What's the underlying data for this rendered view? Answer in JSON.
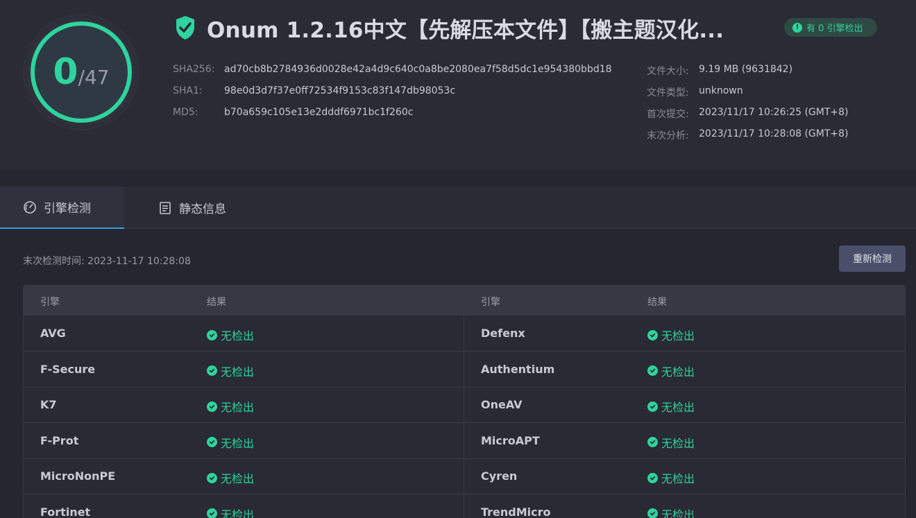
{
  "score": {
    "detected": "0",
    "total": "/47"
  },
  "file": {
    "title": "Onum 1.2.16中文【先解压本文件】【搬主题汉化...",
    "badge": "有 0 引擎检出",
    "badge_icon": "exclamation-icon",
    "hashes": [
      {
        "key": "SHA256:",
        "value": "ad70cb8b2784936d0028e42a4d9c640c0a8be2080ea7f58d5dc1e954380bbd18"
      },
      {
        "key": "SHA1:",
        "value": "98e0d3d7f37e0ff72534f9153c83f147db98053c"
      },
      {
        "key": "MD5:",
        "value": "b70a659c105e13e2dddf6971bc1f260c"
      }
    ],
    "meta": [
      {
        "key": "文件大小:",
        "value": "9.19 MB (9631842)"
      },
      {
        "key": "文件类型:",
        "value": "unknown"
      },
      {
        "key": "首次提交:",
        "value": "2023/11/17 10:26:25 (GMT+8)"
      },
      {
        "key": "末次分析:",
        "value": "2023/11/17 10:28:08 (GMT+8)"
      }
    ]
  },
  "tabs": [
    {
      "label": "引擎检测",
      "icon": "gauge-icon",
      "active": true
    },
    {
      "label": "静态信息",
      "icon": "document-list-icon",
      "active": false
    }
  ],
  "detection": {
    "last_check": "末次检测时间: 2023-11-17 10:28:08",
    "recheck_label": "重新检测",
    "headers": {
      "engine": "引擎",
      "result": "结果"
    },
    "rows": [
      {
        "left": {
          "engine": "AVG",
          "result": "无检出"
        },
        "right": {
          "engine": "Defenx",
          "result": "无检出"
        }
      },
      {
        "left": {
          "engine": "F-Secure",
          "result": "无检出"
        },
        "right": {
          "engine": "Authentium",
          "result": "无检出"
        }
      },
      {
        "left": {
          "engine": "K7",
          "result": "无检出"
        },
        "right": {
          "engine": "OneAV",
          "result": "无检出"
        }
      },
      {
        "left": {
          "engine": "F-Prot",
          "result": "无检出"
        },
        "right": {
          "engine": "MicroAPT",
          "result": "无检出"
        }
      },
      {
        "left": {
          "engine": "MicroNonPE",
          "result": "无检出"
        },
        "right": {
          "engine": "Cyren",
          "result": "无检出"
        }
      },
      {
        "left": {
          "engine": "Fortinet",
          "result": "无检出"
        },
        "right": {
          "engine": "TrendMicro",
          "result": "无检出"
        }
      }
    ]
  },
  "colors": {
    "accent": "#2fd39d",
    "tab_active": "#3b9ae1",
    "button": "#4a4e69"
  }
}
